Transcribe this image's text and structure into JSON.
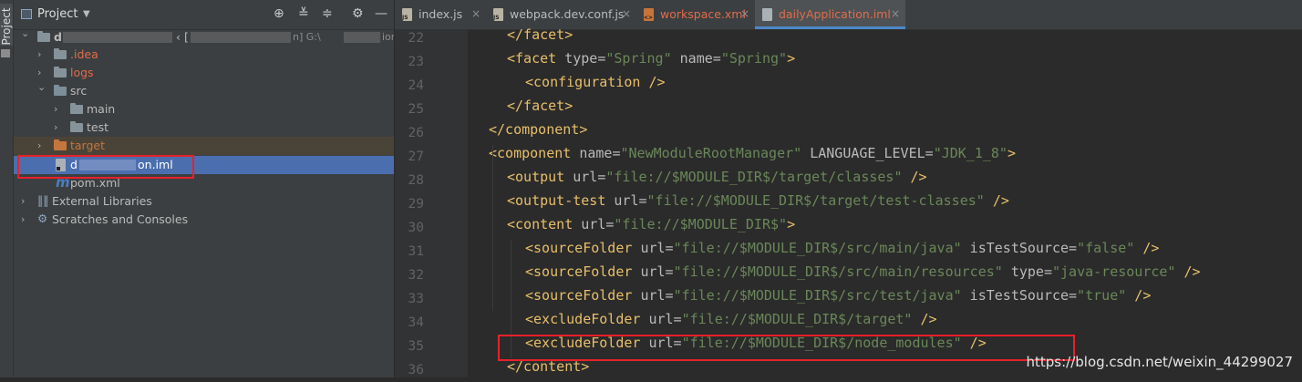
{
  "side_strip": {
    "tab_label": "Project"
  },
  "project_panel": {
    "title": "Project",
    "toolbar_icons": [
      "locate-icon",
      "expand-all-icon",
      "collapse-all-icon",
      "gear-icon",
      "minimize-icon"
    ],
    "tree": [
      {
        "label": "d",
        "suffix": "‹ [",
        "path_hint": "n]  G:\\",
        "path_tail": "ion",
        "type": "module-root",
        "expanded": true
      },
      {
        "label": ".idea",
        "type": "folder",
        "color": "#e06c4c"
      },
      {
        "label": "logs",
        "type": "folder",
        "color": "#e06c4c"
      },
      {
        "label": "src",
        "type": "folder",
        "expanded": true
      },
      {
        "label": "main",
        "type": "folder"
      },
      {
        "label": "test",
        "type": "folder"
      },
      {
        "label": "target",
        "type": "folder-excluded",
        "color": "#c5763d"
      },
      {
        "label": "d",
        "tail": "on.iml",
        "type": "iml-file",
        "selected": true
      },
      {
        "label": "pom.xml",
        "type": "maven-file"
      },
      {
        "label": "External Libraries",
        "type": "libraries"
      },
      {
        "label": "Scratches and Consoles",
        "type": "scratches"
      }
    ]
  },
  "editor": {
    "tabs": [
      {
        "label": "index.js",
        "icon": "js-file-icon",
        "active": false
      },
      {
        "label": "webpack.dev.conf.js",
        "icon": "js-file-icon",
        "active": false
      },
      {
        "label": "workspace.xml",
        "icon": "xml-file-icon",
        "active": false,
        "color": "#e06c4c"
      },
      {
        "label": "dailyApplication.iml",
        "icon": "iml-file-icon",
        "active": true,
        "color": "#e06c4c"
      }
    ],
    "close_glyph": "×",
    "line_numbers": [
      "22",
      "23",
      "24",
      "25",
      "26",
      "27",
      "28",
      "29",
      "30",
      "31",
      "32",
      "33",
      "34",
      "35",
      "36"
    ],
    "lines": [
      [
        [
          "tag",
          "</facet>"
        ]
      ],
      [
        [
          "tag",
          "<facet "
        ],
        [
          "attr",
          "type="
        ],
        [
          "val",
          "\"Spring\""
        ],
        [
          "attr",
          " name="
        ],
        [
          "val",
          "\"Spring\""
        ],
        [
          "tag",
          ">"
        ]
      ],
      [
        [
          "tag",
          "<configuration />"
        ]
      ],
      [
        [
          "tag",
          "</facet>"
        ]
      ],
      [
        [
          "tag",
          "</component>"
        ]
      ],
      [
        [
          "tag",
          "<component "
        ],
        [
          "attr",
          "name="
        ],
        [
          "val",
          "\"NewModuleRootManager\""
        ],
        [
          "attr",
          " LANGUAGE_LEVEL="
        ],
        [
          "val",
          "\"JDK_1_8\""
        ],
        [
          "tag",
          ">"
        ]
      ],
      [
        [
          "tag",
          "<output "
        ],
        [
          "attr",
          "url="
        ],
        [
          "val",
          "\"file://$MODULE_DIR$/target/classes\""
        ],
        [
          "tag",
          " />"
        ]
      ],
      [
        [
          "tag",
          "<output-test "
        ],
        [
          "attr",
          "url="
        ],
        [
          "val",
          "\"file://$MODULE_DIR$/target/test-classes\""
        ],
        [
          "tag",
          " />"
        ]
      ],
      [
        [
          "tag",
          "<content "
        ],
        [
          "attr",
          "url="
        ],
        [
          "val",
          "\"file://$MODULE_DIR$\""
        ],
        [
          "tag",
          ">"
        ]
      ],
      [
        [
          "tag",
          "<sourceFolder "
        ],
        [
          "attr",
          "url="
        ],
        [
          "val",
          "\"file://$MODULE_DIR$/src/main/java\""
        ],
        [
          "attr",
          " isTestSource="
        ],
        [
          "val",
          "\"false\""
        ],
        [
          "tag",
          " />"
        ]
      ],
      [
        [
          "tag",
          "<sourceFolder "
        ],
        [
          "attr",
          "url="
        ],
        [
          "val",
          "\"file://$MODULE_DIR$/src/main/resources\""
        ],
        [
          "attr",
          " type="
        ],
        [
          "val",
          "\"java-resource\""
        ],
        [
          "tag",
          " />"
        ]
      ],
      [
        [
          "tag",
          "<sourceFolder "
        ],
        [
          "attr",
          "url="
        ],
        [
          "val",
          "\"file://$MODULE_DIR$/src/test/java\""
        ],
        [
          "attr",
          " isTestSource="
        ],
        [
          "val",
          "\"true\""
        ],
        [
          "tag",
          " />"
        ]
      ],
      [
        [
          "tag",
          "<excludeFolder "
        ],
        [
          "attr",
          "url="
        ],
        [
          "val",
          "\"file://$MODULE_DIR$/target\""
        ],
        [
          "tag",
          " />"
        ]
      ],
      [
        [
          "tag",
          "<excludeFolder "
        ],
        [
          "attr",
          "url="
        ],
        [
          "val",
          "\"file://$MODULE_DIR$/node_modules\""
        ],
        [
          "tag",
          " />"
        ]
      ],
      [
        [
          "tag",
          "</content>"
        ]
      ]
    ],
    "indents": [
      2,
      2,
      3,
      2,
      1,
      1,
      2,
      2,
      2,
      3,
      3,
      3,
      3,
      3,
      2
    ]
  },
  "watermark": "https://blog.csdn.net/weixin_44299027",
  "colors": {
    "tag": "#e8bf6a",
    "attr": "#bababa",
    "value": "#6a8759",
    "highlight": "#e8212a",
    "selection": "#4b6eaf"
  }
}
